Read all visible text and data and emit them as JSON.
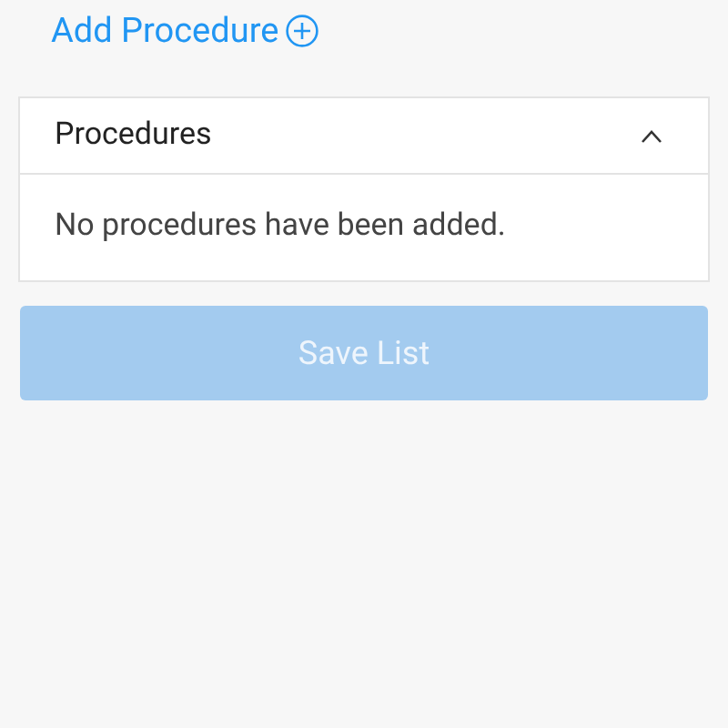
{
  "add_link": {
    "label": "Add Procedure"
  },
  "panel": {
    "title": "Procedures",
    "expanded": true,
    "empty_message": "No procedures have been added."
  },
  "save_button": {
    "label": "Save List",
    "disabled": true
  }
}
